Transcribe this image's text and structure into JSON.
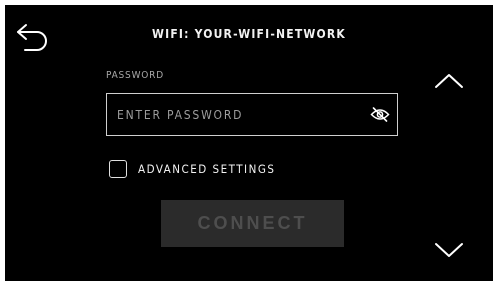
{
  "header": {
    "title": "WIFI: YOUR-WIFI-NETWORK",
    "back_icon": "back-arrow-icon"
  },
  "password": {
    "label": "PASSWORD",
    "placeholder": "ENTER PASSWORD",
    "value": "",
    "visibility_icon": "eye-slash-icon"
  },
  "advanced": {
    "label": "ADVANCED SETTINGS",
    "checked": false
  },
  "connect": {
    "label": "CONNECT",
    "enabled": false
  },
  "nav": {
    "up_icon": "chevron-up-icon",
    "down_icon": "chevron-down-icon"
  },
  "colors": {
    "background": "#000000",
    "text": "#ffffff",
    "muted_text": "#a8a8a8",
    "button_disabled_bg": "#2b2b2b",
    "button_disabled_text": "#4e4e4e"
  }
}
